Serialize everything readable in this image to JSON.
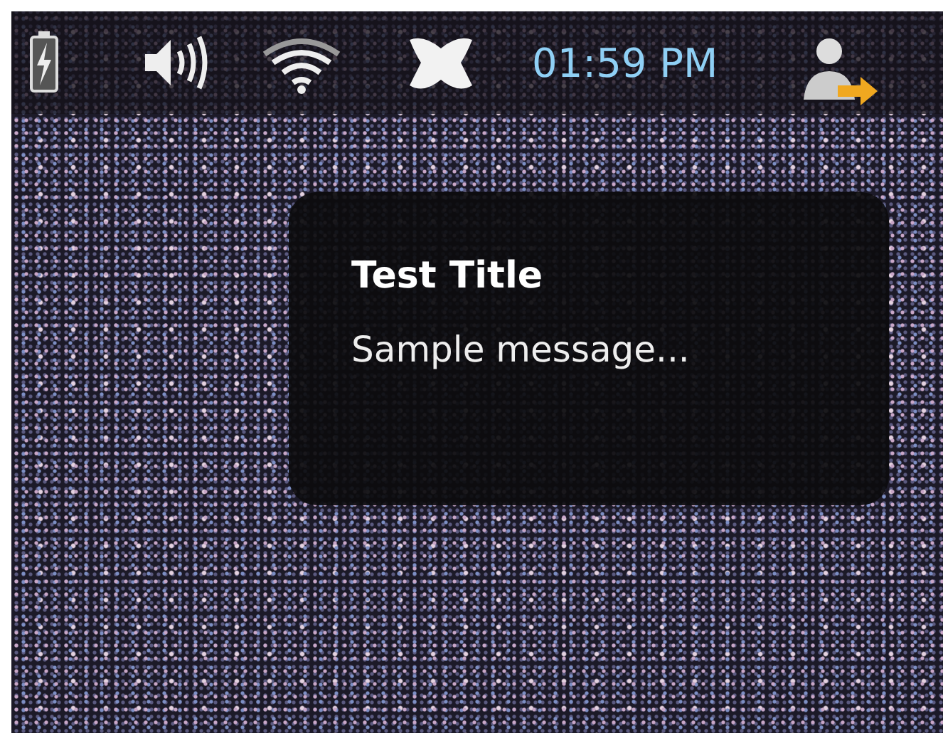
{
  "panel": {
    "clock": "01:59 PM"
  },
  "notification": {
    "title": "Test Title",
    "message": "Sample message..."
  }
}
